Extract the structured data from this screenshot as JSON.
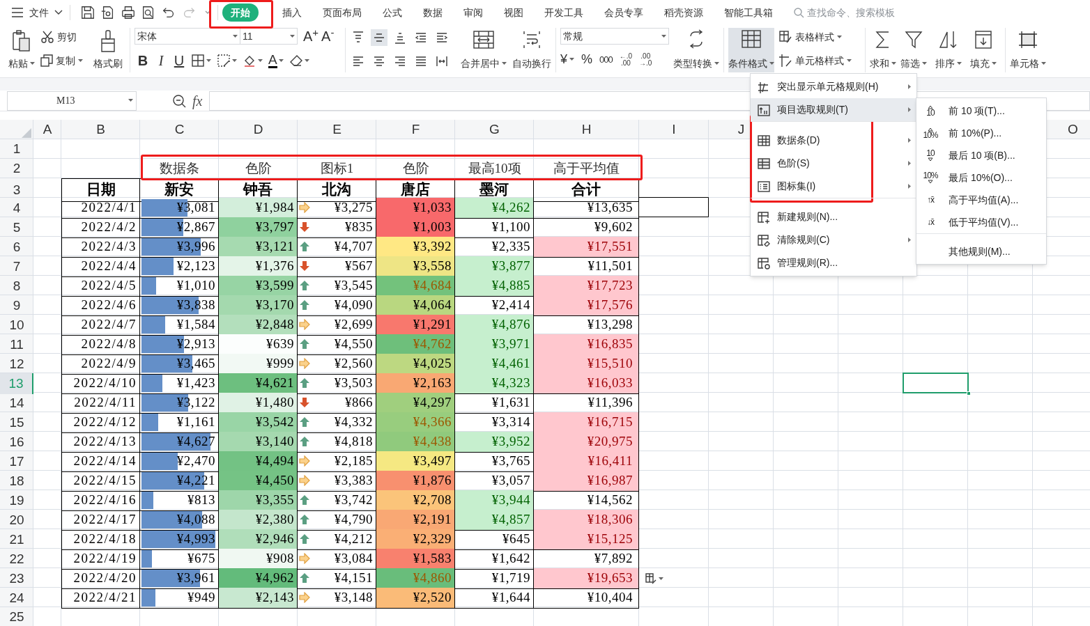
{
  "topbar": {
    "menu_label": "文件",
    "tabs": [
      {
        "label": "开始",
        "selected": true
      },
      {
        "label": "插入",
        "selected": false
      },
      {
        "label": "页面布局",
        "selected": false
      },
      {
        "label": "公式",
        "selected": false
      },
      {
        "label": "数据",
        "selected": false
      },
      {
        "label": "审阅",
        "selected": false
      },
      {
        "label": "视图",
        "selected": false
      },
      {
        "label": "开发工具",
        "selected": false
      },
      {
        "label": "会员专享",
        "selected": false
      },
      {
        "label": "稻壳资源",
        "selected": false
      },
      {
        "label": "智能工具箱",
        "selected": false
      }
    ],
    "search": {
      "placeholder": "查找命令、搜索模板"
    }
  },
  "ribbon": {
    "paste": "粘贴",
    "cut": "剪切",
    "copy": "复制",
    "format_painter": "格式刷",
    "font": "宋体",
    "font_size": "11",
    "grow": "A$^{+}$",
    "shrink": "A$^{-}$",
    "bold": "B",
    "italic": "I",
    "underline": "U",
    "font_color": "A",
    "merge": "合并居中",
    "wrap": "自动换行",
    "number_format": "常规",
    "currency": "¥",
    "percent": "%",
    "thousands": "000",
    "decimal_increase": [
      "←.0",
      ".00"
    ],
    "decimal_decrease": [
      ".00",
      "→.0"
    ],
    "convert": "类型转换",
    "conditional": {
      "label": "条件格式",
      "active": true
    },
    "table_style": "表格样式",
    "cell_style": "单元格样式",
    "sum": "求和",
    "filter": "筛选",
    "sort": "排序",
    "fill": "填充",
    "cells": "单元格"
  },
  "formula_bar": {
    "name_box": "M13",
    "fx": "fx"
  },
  "sheet": {
    "columns": [
      "A",
      "B",
      "C",
      "D",
      "E",
      "F",
      "G",
      "H",
      "I",
      "J"
    ],
    "columns_right": [
      "O"
    ],
    "row_numbers": [
      {
        "label": "1",
        "selected": false
      },
      {
        "label": "2",
        "selected": false
      },
      {
        "label": "3",
        "selected": false
      },
      {
        "label": "4",
        "selected": false
      },
      {
        "label": "5",
        "selected": false
      },
      {
        "label": "6",
        "selected": false
      },
      {
        "label": "7",
        "selected": false
      },
      {
        "label": "8",
        "selected": false
      },
      {
        "label": "9",
        "selected": false
      },
      {
        "label": "10",
        "selected": false
      },
      {
        "label": "11",
        "selected": false
      },
      {
        "label": "12",
        "selected": false
      },
      {
        "label": "13",
        "selected": true
      },
      {
        "label": "14",
        "selected": false
      },
      {
        "label": "15",
        "selected": false
      },
      {
        "label": "16",
        "selected": false
      },
      {
        "label": "17",
        "selected": false
      },
      {
        "label": "18",
        "selected": false
      },
      {
        "label": "19",
        "selected": false
      },
      {
        "label": "20",
        "selected": false
      },
      {
        "label": "21",
        "selected": false
      },
      {
        "label": "22",
        "selected": false
      },
      {
        "label": "23",
        "selected": false
      },
      {
        "label": "24",
        "selected": false
      },
      {
        "label": "25",
        "selected": false
      }
    ],
    "labels_row": [
      "数据条",
      "色阶",
      "图标1",
      "色阶",
      "最高10项",
      "高于平均值"
    ],
    "header_row": [
      "日期",
      "新安",
      "钟吾",
      "北沟",
      "唐店",
      "墨河",
      "合计"
    ],
    "records": [
      {
        "date": "2022/4/1",
        "xinan": {
          "value": "¥3,081",
          "level": 0.62
        },
        "zhongwu": {
          "value": "¥1,984",
          "color": "#d3eedb"
        },
        "beigou": {
          "value": "¥3,275",
          "kind": "flat"
        },
        "tangdian": {
          "value": "¥1,033",
          "color": "#f8696b",
          "top10": false
        },
        "mohe": {
          "value": "¥4,262",
          "highlighted": true
        },
        "total": {
          "value": "¥13,635",
          "above_average": false
        }
      },
      {
        "date": "2022/4/2",
        "xinan": {
          "value": "¥2,867",
          "level": 0.57
        },
        "zhongwu": {
          "value": "¥3,797",
          "color": "#8fd19e"
        },
        "beigou": {
          "value": "¥835",
          "kind": "down"
        },
        "tangdian": {
          "value": "¥1,003",
          "color": "#f8696b",
          "top10": false
        },
        "mohe": {
          "value": "¥1,100",
          "highlighted": false
        },
        "total": {
          "value": "¥9,602",
          "above_average": false
        }
      },
      {
        "date": "2022/4/3",
        "xinan": {
          "value": "¥3,996",
          "level": 0.8
        },
        "zhongwu": {
          "value": "¥3,121",
          "color": "#a6dab0"
        },
        "beigou": {
          "value": "¥4,707",
          "kind": "up"
        },
        "tangdian": {
          "value": "¥3,392",
          "color": "#ffe884",
          "top10": false
        },
        "mohe": {
          "value": "¥2,335",
          "highlighted": false
        },
        "total": {
          "value": "¥17,551",
          "above_average": true
        }
      },
      {
        "date": "2022/4/4",
        "xinan": {
          "value": "¥2,123",
          "level": 0.43
        },
        "zhongwu": {
          "value": "¥1,376",
          "color": "#e4f4e8"
        },
        "beigou": {
          "value": "¥567",
          "kind": "down"
        },
        "tangdian": {
          "value": "¥3,558",
          "color": "#eee585",
          "top10": false
        },
        "mohe": {
          "value": "¥3,877",
          "highlighted": true
        },
        "total": {
          "value": "¥11,501",
          "above_average": false
        }
      },
      {
        "date": "2022/4/5",
        "xinan": {
          "value": "¥1,010",
          "level": 0.2
        },
        "zhongwu": {
          "value": "¥3,599",
          "color": "#97d4a4"
        },
        "beigou": {
          "value": "¥3,545",
          "kind": "up"
        },
        "tangdian": {
          "value": "¥4,684",
          "color": "#73c27c",
          "top10": true
        },
        "mohe": {
          "value": "¥4,885",
          "highlighted": true
        },
        "total": {
          "value": "¥17,723",
          "above_average": true
        }
      },
      {
        "date": "2022/4/6",
        "xinan": {
          "value": "¥3,838",
          "level": 0.77
        },
        "zhongwu": {
          "value": "¥3,170",
          "color": "#a4d9ae"
        },
        "beigou": {
          "value": "¥4,090",
          "kind": "up"
        },
        "tangdian": {
          "value": "¥4,064",
          "color": "#b9d780",
          "top10": false
        },
        "mohe": {
          "value": "¥2,414",
          "highlighted": false
        },
        "total": {
          "value": "¥17,576",
          "above_average": true
        }
      },
      {
        "date": "2022/4/7",
        "xinan": {
          "value": "¥1,584",
          "level": 0.32
        },
        "zhongwu": {
          "value": "¥2,848",
          "color": "#b3dfbc"
        },
        "beigou": {
          "value": "¥2,699",
          "kind": "flat"
        },
        "tangdian": {
          "value": "¥1,291",
          "color": "#f8786d",
          "top10": false
        },
        "mohe": {
          "value": "¥4,876",
          "highlighted": true
        },
        "total": {
          "value": "¥13,298",
          "above_average": false
        }
      },
      {
        "date": "2022/4/8",
        "xinan": {
          "value": "¥2,913",
          "level": 0.58
        },
        "zhongwu": {
          "value": "¥639",
          "color": "#fcfefd"
        },
        "beigou": {
          "value": "¥4,550",
          "kind": "up"
        },
        "tangdian": {
          "value": "¥4,762",
          "color": "#6ebf7b",
          "top10": true
        },
        "mohe": {
          "value": "¥3,971",
          "highlighted": true
        },
        "total": {
          "value": "¥16,835",
          "above_average": true
        }
      },
      {
        "date": "2022/4/9",
        "xinan": {
          "value": "¥3,465",
          "level": 0.69
        },
        "zhongwu": {
          "value": "¥999",
          "color": "#f2f9f4"
        },
        "beigou": {
          "value": "¥2,560",
          "kind": "flat"
        },
        "tangdian": {
          "value": "¥4,025",
          "color": "#bdd881",
          "top10": false
        },
        "mohe": {
          "value": "¥4,461",
          "highlighted": true
        },
        "total": {
          "value": "¥15,510",
          "above_average": true
        }
      },
      {
        "date": "2022/4/10",
        "xinan": {
          "value": "¥1,423",
          "level": 0.28
        },
        "zhongwu": {
          "value": "¥4,621",
          "color": "#6dbf7f"
        },
        "beigou": {
          "value": "¥3,503",
          "kind": "up"
        },
        "tangdian": {
          "value": "¥2,163",
          "color": "#f9a873",
          "top10": false
        },
        "mohe": {
          "value": "¥4,323",
          "highlighted": true
        },
        "total": {
          "value": "¥16,033",
          "above_average": true
        }
      },
      {
        "date": "2022/4/11",
        "xinan": {
          "value": "¥3,122",
          "level": 0.63
        },
        "zhongwu": {
          "value": "¥1,480",
          "color": "#e0f2e5"
        },
        "beigou": {
          "value": "¥866",
          "kind": "down"
        },
        "tangdian": {
          "value": "¥4,297",
          "color": "#a0cf7e",
          "top10": false
        },
        "mohe": {
          "value": "¥1,631",
          "highlighted": false
        },
        "total": {
          "value": "¥11,396",
          "above_average": false
        }
      },
      {
        "date": "2022/4/12",
        "xinan": {
          "value": "¥1,161",
          "level": 0.23
        },
        "zhongwu": {
          "value": "¥3,542",
          "color": "#99d5a6"
        },
        "beigou": {
          "value": "¥4,332",
          "kind": "up"
        },
        "tangdian": {
          "value": "¥4,366",
          "color": "#98cd7e",
          "top10": true
        },
        "mohe": {
          "value": "¥3,314",
          "highlighted": false
        },
        "total": {
          "value": "¥16,715",
          "above_average": true
        }
      },
      {
        "date": "2022/4/13",
        "xinan": {
          "value": "¥4,627",
          "level": 0.93
        },
        "zhongwu": {
          "value": "¥3,140",
          "color": "#a5d9af"
        },
        "beigou": {
          "value": "¥4,818",
          "kind": "up"
        },
        "tangdian": {
          "value": "¥4,438",
          "color": "#90ca7d",
          "top10": true
        },
        "mohe": {
          "value": "¥3,952",
          "highlighted": true
        },
        "total": {
          "value": "¥20,975",
          "above_average": true
        }
      },
      {
        "date": "2022/4/14",
        "xinan": {
          "value": "¥2,470",
          "level": 0.49
        },
        "zhongwu": {
          "value": "¥4,494",
          "color": "#73c284"
        },
        "beigou": {
          "value": "¥2,185",
          "kind": "flat"
        },
        "tangdian": {
          "value": "¥3,497",
          "color": "#f5e882",
          "top10": false
        },
        "mohe": {
          "value": "¥3,765",
          "highlighted": false
        },
        "total": {
          "value": "¥16,411",
          "above_average": true
        }
      },
      {
        "date": "2022/4/15",
        "xinan": {
          "value": "¥4,221",
          "level": 0.85
        },
        "zhongwu": {
          "value": "¥4,450",
          "color": "#75c385"
        },
        "beigou": {
          "value": "¥3,383",
          "kind": "flat"
        },
        "tangdian": {
          "value": "¥1,876",
          "color": "#f8906f",
          "top10": false
        },
        "mohe": {
          "value": "¥3,057",
          "highlighted": false
        },
        "total": {
          "value": "¥16,987",
          "above_average": true
        }
      },
      {
        "date": "2022/4/16",
        "xinan": {
          "value": "¥813",
          "level": 0.16
        },
        "zhongwu": {
          "value": "¥3,355",
          "color": "#9ed6aa"
        },
        "beigou": {
          "value": "¥3,742",
          "kind": "up"
        },
        "tangdian": {
          "value": "¥2,708",
          "color": "#fbc47a",
          "top10": false
        },
        "mohe": {
          "value": "¥3,944",
          "highlighted": true
        },
        "total": {
          "value": "¥14,562",
          "above_average": false
        }
      },
      {
        "date": "2022/4/17",
        "xinan": {
          "value": "¥4,088",
          "level": 0.82
        },
        "zhongwu": {
          "value": "¥2,380",
          "color": "#c4e6cc"
        },
        "beigou": {
          "value": "¥4,790",
          "kind": "up"
        },
        "tangdian": {
          "value": "¥2,191",
          "color": "#f9a874",
          "top10": false
        },
        "mohe": {
          "value": "¥4,857",
          "highlighted": true
        },
        "total": {
          "value": "¥18,306",
          "above_average": true
        }
      },
      {
        "date": "2022/4/18",
        "xinan": {
          "value": "¥4,993",
          "level": 1
        },
        "zhongwu": {
          "value": "¥2,946",
          "color": "#b0deba"
        },
        "beigou": {
          "value": "¥4,212",
          "kind": "up"
        },
        "tangdian": {
          "value": "¥2,329",
          "color": "#faaf75",
          "top10": false
        },
        "mohe": {
          "value": "¥645",
          "highlighted": false
        },
        "total": {
          "value": "¥15,125",
          "above_average": true
        }
      },
      {
        "date": "2022/4/19",
        "xinan": {
          "value": "¥675",
          "level": 0.14
        },
        "zhongwu": {
          "value": "¥908",
          "color": "#f0f8f2"
        },
        "beigou": {
          "value": "¥3,084",
          "kind": "flat"
        },
        "tangdian": {
          "value": "¥1,583",
          "color": "#f8816e",
          "top10": false
        },
        "mohe": {
          "value": "¥1,642",
          "highlighted": false
        },
        "total": {
          "value": "¥7,892",
          "above_average": false
        }
      },
      {
        "date": "2022/4/20",
        "xinan": {
          "value": "¥3,961",
          "level": 0.79
        },
        "zhongwu": {
          "value": "¥4,962",
          "color": "#63bb7b"
        },
        "beigou": {
          "value": "¥4,151",
          "kind": "up"
        },
        "tangdian": {
          "value": "¥4,860",
          "color": "#69bd7b",
          "top10": true
        },
        "mohe": {
          "value": "¥1,719",
          "highlighted": false
        },
        "total": {
          "value": "¥19,653",
          "above_average": true
        }
      },
      {
        "date": "2022/4/21",
        "xinan": {
          "value": "¥949",
          "level": 0.19
        },
        "zhongwu": {
          "value": "¥2,143",
          "color": "#c8e8d0"
        },
        "beigou": {
          "value": "¥3,148",
          "kind": "flat"
        },
        "tangdian": {
          "value": "¥2,520",
          "color": "#fabb78",
          "top10": false
        },
        "mohe": {
          "value": "¥1,644",
          "highlighted": false
        },
        "total": {
          "value": "¥10,404",
          "above_average": false
        }
      }
    ]
  },
  "conditional_menu": {
    "items": [
      {
        "label": "突出显示单元格规则(H)",
        "submenu": true,
        "selected": false,
        "separator_before": false
      },
      {
        "label": "项目选取规则(T)",
        "submenu": true,
        "selected": true,
        "separator_before": false
      },
      {
        "label": "数据条(D)",
        "submenu": true,
        "selected": false,
        "separator_before": true
      },
      {
        "label": "色阶(S)",
        "submenu": true,
        "selected": false,
        "separator_before": false
      },
      {
        "label": "图标集(I)",
        "submenu": true,
        "selected": false,
        "separator_before": false
      },
      {
        "label": "新建规则(N)...",
        "submenu": false,
        "selected": false,
        "separator_before": true
      },
      {
        "label": "清除规则(C)",
        "submenu": true,
        "selected": false,
        "separator_before": false
      },
      {
        "label": "管理规则(R)...",
        "submenu": false,
        "selected": false,
        "separator_before": false
      }
    ],
    "submenu": [
      {
        "label": "前 10 项(T)...",
        "badge": "10",
        "kind": "up",
        "separator_before": false
      },
      {
        "label": "前 10%(P)...",
        "badge": "10%",
        "kind": "up",
        "separator_before": false
      },
      {
        "label": "最后 10 项(B)...",
        "badge": "10",
        "kind": "down",
        "separator_before": false
      },
      {
        "label": "最后 10%(O)...",
        "badge": "10%",
        "kind": "down",
        "separator_before": false
      },
      {
        "label": "高于平均值(A)...",
        "badge": "↑x̄",
        "separator_before": false
      },
      {
        "label": "低于平均值(V)...",
        "badge": "↓x̄",
        "separator_before": false
      },
      {
        "label": "其他规则(M)...",
        "separator_before": true
      }
    ]
  }
}
